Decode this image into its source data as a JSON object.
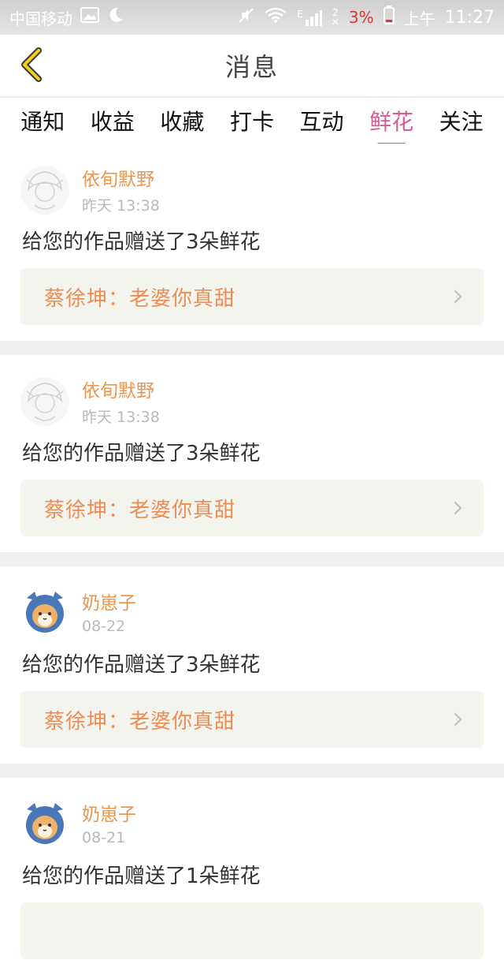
{
  "status_bar": {
    "carrier": "中国移动",
    "battery_percent": "3%",
    "ampm": "上午",
    "time": "11:27",
    "signal_label": "E",
    "sim_label": "2"
  },
  "header": {
    "title": "消息",
    "back_icon": "chevron-left-icon"
  },
  "tabs": [
    {
      "label": "通知"
    },
    {
      "label": "收益"
    },
    {
      "label": "收藏"
    },
    {
      "label": "打卡"
    },
    {
      "label": "互动"
    },
    {
      "label": "鲜花"
    },
    {
      "label": "关注"
    }
  ],
  "messages": [
    {
      "username": "依旬默野",
      "time": "昨天 13:38",
      "text": "给您的作品赠送了3朵鲜花",
      "work_title": "蔡徐坤：老婆你真甜"
    },
    {
      "username": "依旬默野",
      "time": "昨天 13:38",
      "text": "给您的作品赠送了3朵鲜花",
      "work_title": "蔡徐坤：老婆你真甜"
    },
    {
      "username": "奶崽子",
      "time": "08-22",
      "text": "给您的作品赠送了3朵鲜花",
      "work_title": "蔡徐坤：老婆你真甜"
    },
    {
      "username": "奶崽子",
      "time": "08-21",
      "text": "给您的作品赠送了1朵鲜花",
      "work_title": ""
    }
  ],
  "colors": {
    "accent": "#d75a97",
    "username": "#e9964f",
    "work_title": "#ec8d54",
    "back": "#e6c200"
  }
}
